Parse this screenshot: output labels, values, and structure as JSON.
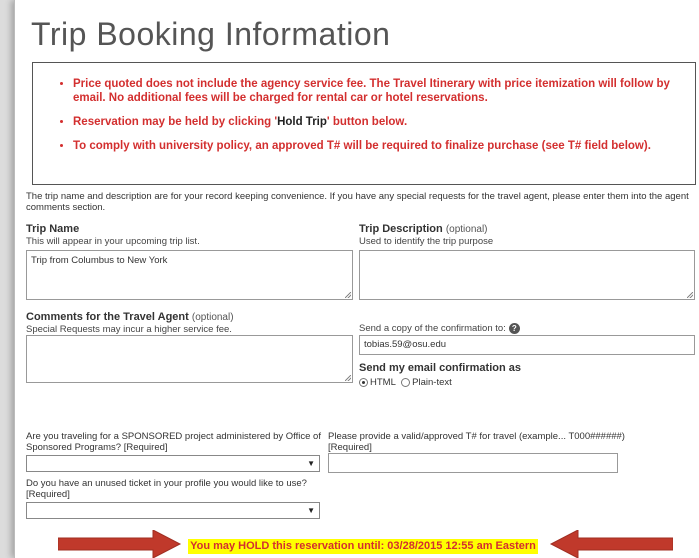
{
  "page": {
    "title": "Trip Booking Information"
  },
  "notice": {
    "items": [
      {
        "text": "Price quoted does not include the agency service fee. The Travel Itinerary with price itemization will follow by email. No additional fees will be charged for rental car or hotel reservations."
      },
      {
        "pre": "Reservation may be held by clicking '",
        "bold": "Hold Trip",
        "post": "' button below."
      },
      {
        "text": "To comply with university policy, an approved T# will be required to finalize purchase (see T# field below)."
      }
    ]
  },
  "intro": "The trip name and description are for your record keeping convenience. If you have any special requests for the travel agent, please enter them into the agent comments section.",
  "trip_name": {
    "label": "Trip Name",
    "help": "This will appear in your upcoming trip list.",
    "value": "Trip from Columbus to New York"
  },
  "trip_description": {
    "label": "Trip Description",
    "optional": "(optional)",
    "help": "Used to identify the trip purpose",
    "value": ""
  },
  "comments": {
    "label": "Comments for the Travel Agent",
    "optional": "(optional)",
    "help": "Special Requests may incur a higher service fee.",
    "value": ""
  },
  "copy_confirmation": {
    "label": "Send a copy of the confirmation to:",
    "help_icon": "?",
    "value": "tobias.59@osu.edu"
  },
  "email_format": {
    "label": "Send my email confirmation as",
    "options": [
      "HTML",
      "Plain-text"
    ],
    "selected": "HTML"
  },
  "sponsored": {
    "question": "Are you traveling for a SPONSORED project administered by Office of Sponsored Programs? [Required]",
    "value": ""
  },
  "t_number": {
    "question": "Please provide a valid/approved T# for travel (example... T000######) [Required]",
    "value": ""
  },
  "unused_ticket": {
    "question": "Do you have an unused ticket in your profile you would like to use? [Required]",
    "value": ""
  },
  "hold_banner": {
    "text": "You may HOLD this reservation until: 03/28/2015 12:55 am Eastern"
  },
  "colors": {
    "notice_red": "#d32f2f",
    "highlight_yellow": "#ffff00",
    "arrow_red": "#c0392b"
  },
  "icons": {
    "select_arrow": "▼"
  }
}
